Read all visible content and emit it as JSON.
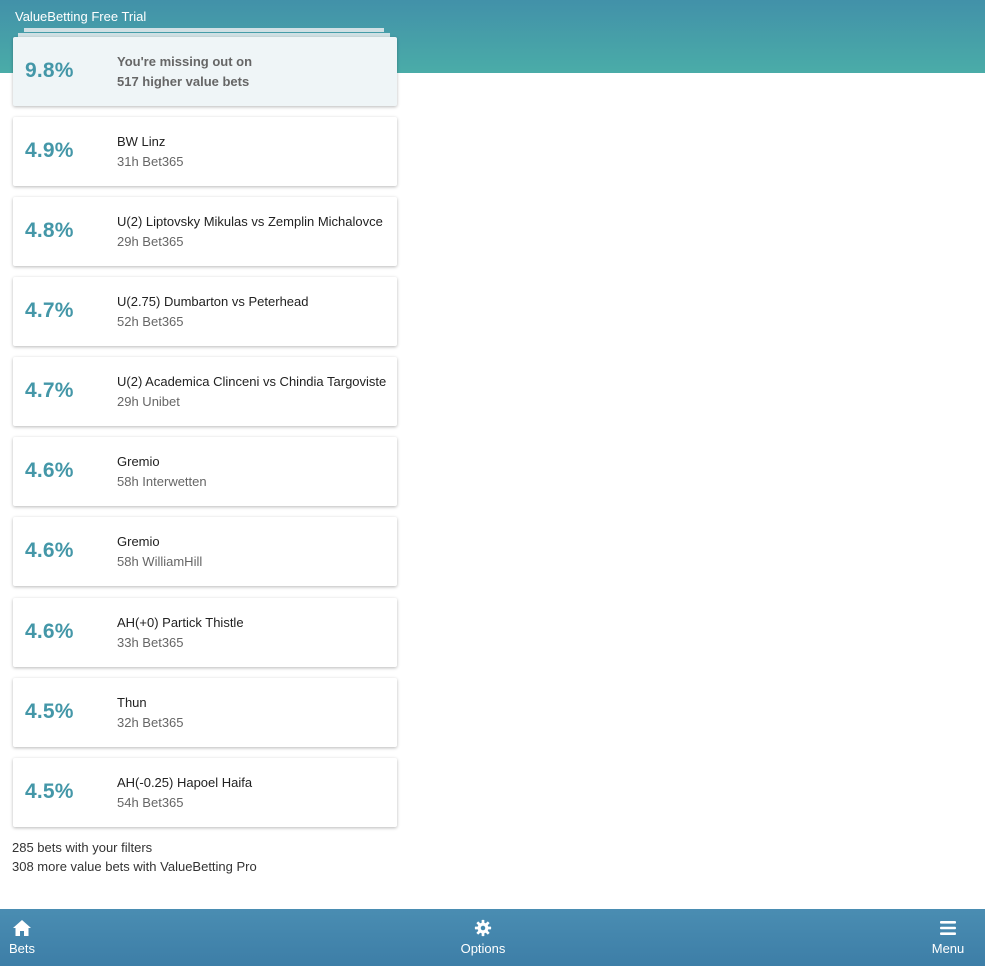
{
  "app": {
    "title": "ValueBetting Free Trial"
  },
  "promo": {
    "percent": "9.8%",
    "line1": "You're missing out on",
    "line2": "517 higher value bets"
  },
  "bets": [
    {
      "percent": "4.9%",
      "title": "BW Linz",
      "detail": "31h Bet365"
    },
    {
      "percent": "4.8%",
      "title": "U(2) Liptovsky Mikulas vs Zemplin Michalovce",
      "detail": "29h Bet365"
    },
    {
      "percent": "4.7%",
      "title": "U(2.75) Dumbarton vs Peterhead",
      "detail": "52h Bet365"
    },
    {
      "percent": "4.7%",
      "title": "U(2) Academica Clinceni vs Chindia Targoviste",
      "detail": "29h Unibet"
    },
    {
      "percent": "4.6%",
      "title": "Gremio",
      "detail": "58h Interwetten"
    },
    {
      "percent": "4.6%",
      "title": "Gremio",
      "detail": "58h WilliamHill"
    },
    {
      "percent": "4.6%",
      "title": "AH(+0) Partick Thistle",
      "detail": "33h Bet365"
    },
    {
      "percent": "4.5%",
      "title": "Thun",
      "detail": "32h Bet365"
    },
    {
      "percent": "4.5%",
      "title": "AH(-0.25) Hapoel Haifa",
      "detail": "54h Bet365"
    }
  ],
  "summary": {
    "filtered": "285 bets with your filters",
    "more": "308 more value bets with ValueBetting Pro"
  },
  "nav": {
    "bets_label": "Bets",
    "options_label": "Options",
    "menu_label": "Menu",
    "bets_icon": "home-icon",
    "options_icon": "gear-icon",
    "menu_icon": "hamburger-icon"
  },
  "colors": {
    "accent": "#4497a8",
    "header_gradient_start": "#4291a9",
    "header_gradient_end": "#4aaca8",
    "navbar": "#4389ae"
  }
}
